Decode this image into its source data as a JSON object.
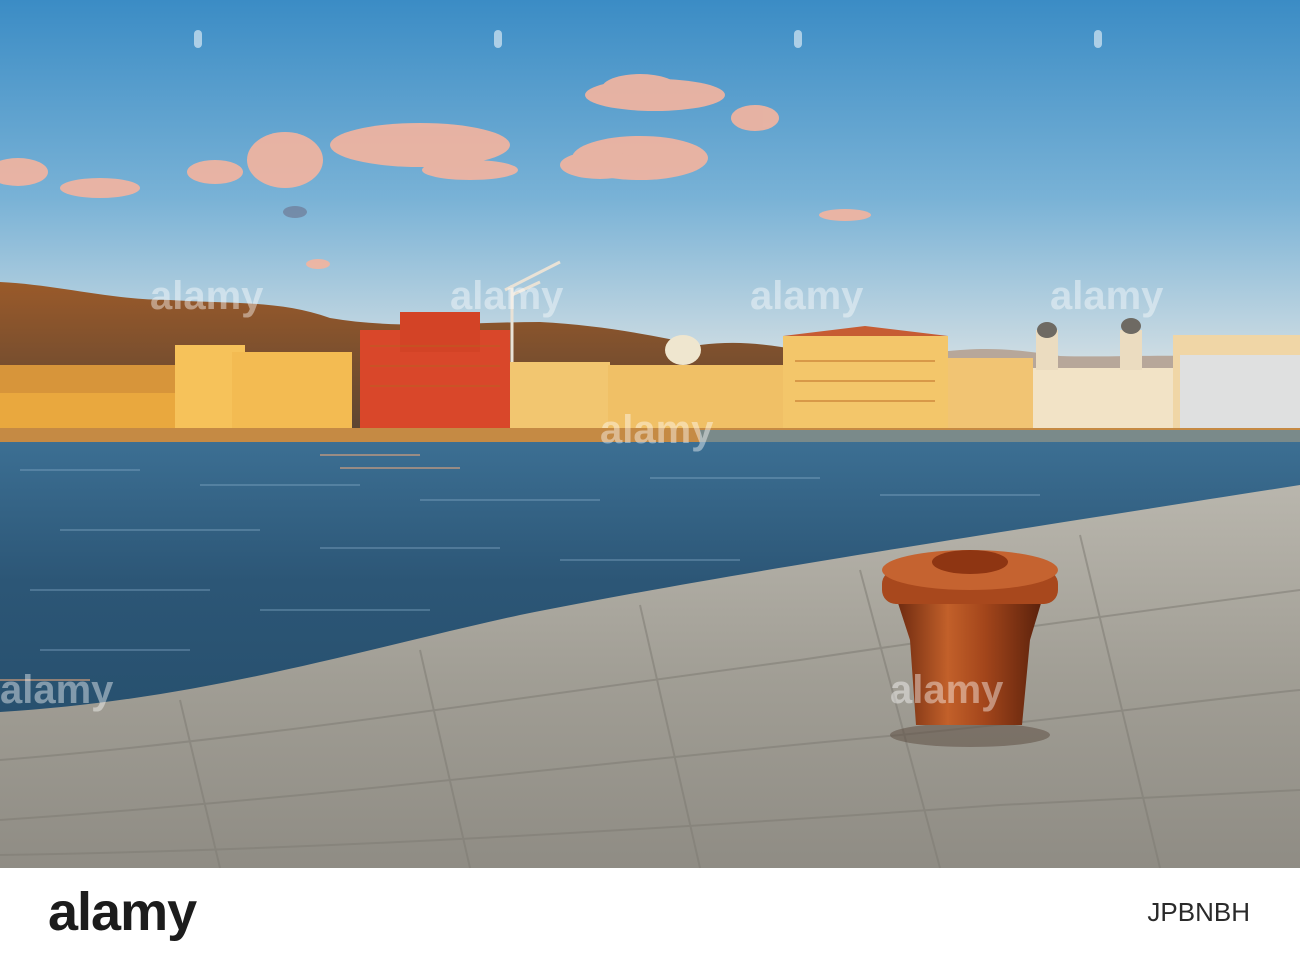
{
  "photo": {
    "subject": "harbour waterfront at sunset with mooring bollard",
    "colors": {
      "sky_top": "#3d8fc7",
      "sky_bottom": "#c8d9e2",
      "water": "#2d5a7a",
      "quay": "#a9a69e",
      "bollard": "#b4501e",
      "sunlit_facade": "#f4b84a"
    }
  },
  "watermark": {
    "text": "alamy"
  },
  "footer": {
    "logo": "alamy",
    "image_id": "JPBNBH"
  }
}
